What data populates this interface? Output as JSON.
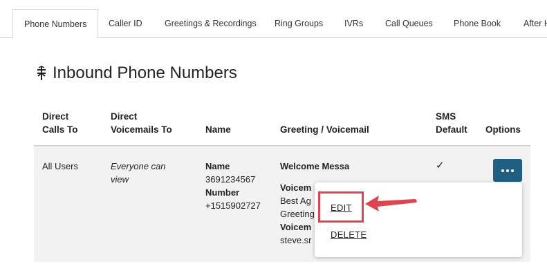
{
  "tabs": [
    {
      "label": "Phone Numbers",
      "active": true
    },
    {
      "label": "Caller ID"
    },
    {
      "label": "Greetings & Recordings"
    },
    {
      "label": "Ring Groups"
    },
    {
      "label": "IVRs"
    },
    {
      "label": "Call Queues"
    },
    {
      "label": "Phone Book"
    },
    {
      "label": "After H"
    }
  ],
  "page": {
    "title": "Inbound Phone Numbers",
    "title_icon": "phone-transfer-icon"
  },
  "table": {
    "headers": {
      "direct_calls_to": [
        "Direct",
        "Calls To"
      ],
      "direct_voicemails_to": [
        "Direct",
        "Voicemails To"
      ],
      "name": "Name",
      "greeting_voicemail": "Greeting / Voicemail",
      "sms_default": [
        "SMS",
        "Default"
      ],
      "options": "Options"
    },
    "rows": [
      {
        "direct_calls_to": "All Users",
        "direct_voicemails_to": [
          "Everyone can",
          "view"
        ],
        "name_label": "Name",
        "name_value": "3691234567",
        "number_label": "Number",
        "number_value": "+1515902727",
        "greeting_title": "Welcome Message",
        "voicemail_label": "Voicem",
        "voicemail_line1": "Best Ag",
        "voicemail_line2": "Greeting",
        "voicemail_label2": "Voicem",
        "voicemail_email": "steve.sr",
        "sms_default": "✓"
      }
    ]
  },
  "options_menu": {
    "items": [
      "EDIT",
      "DELETE"
    ],
    "button_icon": "more-dots-icon"
  },
  "colors": {
    "accent": "#1f5f82",
    "annotation": "#e0434d",
    "row_bg": "#f2f2f2"
  }
}
